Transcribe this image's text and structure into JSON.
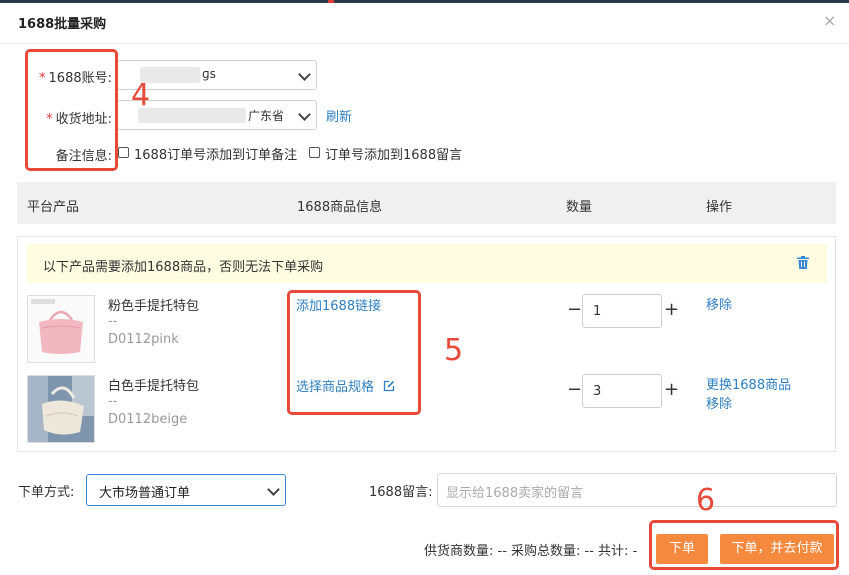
{
  "dialog": {
    "title": "1688批量采购",
    "close_glyph": "×"
  },
  "form": {
    "account_label": "1688账号:",
    "account_value_suffix": "ɡs",
    "address_label": "收货地址:",
    "address_value": "广东省",
    "address_value_tail": "",
    "refresh_label": "刷新",
    "note_label": "备注信息:",
    "note_option1": "1688订单号添加到订单备注",
    "note_option2": "订单号添加到1688留言",
    "required_mark": "*"
  },
  "table": {
    "headers": [
      "平台产品",
      "1688商品信息",
      "数量",
      "操作"
    ],
    "notice": "以下产品需要添加1688商品，否则无法下单采购",
    "rows": [
      {
        "name": "粉色手提托特包",
        "dash": "--",
        "sku": "D0112pink",
        "link_action": "添加1688链接",
        "quantity": "1",
        "actions": [
          "移除"
        ]
      },
      {
        "name": "白色手提托特包",
        "dash": "--",
        "sku": "D0112beige",
        "link_action": "选择商品规格",
        "quantity": "3",
        "actions": [
          "更换1688商品",
          "移除"
        ]
      }
    ]
  },
  "footer": {
    "order_method_label": "下单方式:",
    "order_method_value": "大市场普通订单",
    "message_label": "1688留言:",
    "message_placeholder": "显示给1688卖家的留言",
    "summary": "供货商数量: -- 采购总数量: -- 共计: -",
    "order_button": "下单",
    "order_pay_button": "下单，并去付款"
  },
  "annotations": {
    "a4": "4",
    "a5": "5",
    "a6": "6"
  },
  "colors": {
    "accent": "#f58a3f",
    "link": "#2f7fc1",
    "annotation": "#e84a3a",
    "notice_bg": "#fefde2"
  },
  "icons": {
    "close": "close-icon",
    "trash": "trash-icon",
    "edit": "edit-icon",
    "chevron": "chevron-down-icon"
  }
}
